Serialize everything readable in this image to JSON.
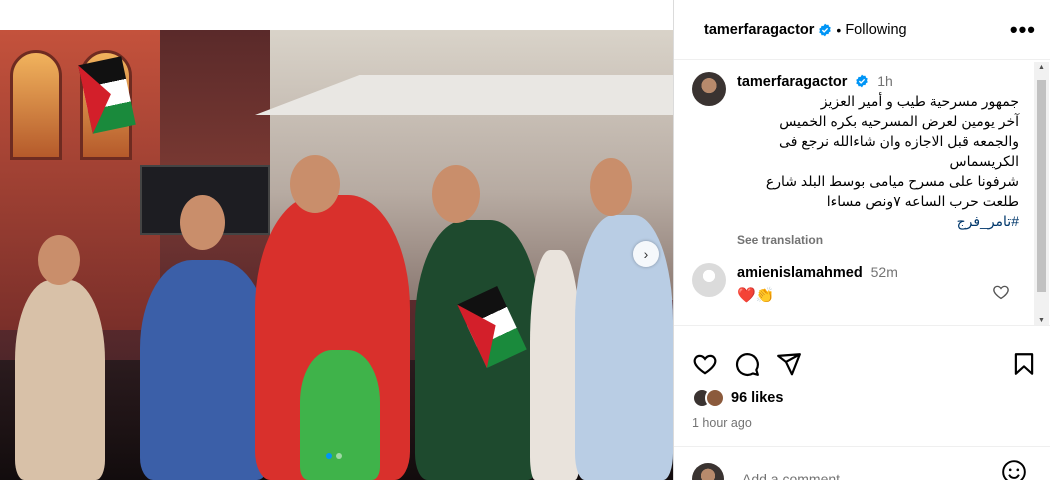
{
  "post": {
    "author": "tamerfaragactor",
    "follow_status": "Following",
    "separator": "•",
    "more_icon": "more-horizontal-icon",
    "caption_time": "1h",
    "caption_lines": [
      "جمهور مسرحية طيب و أمير العزيز",
      "آخر يومين لعرض المسرحيه بكره الخميس",
      "والجمعه قبل الاجازه وان شاءالله نرجع فى",
      "الكريسماس",
      "شرفونا على مسرح ميامى بوسط البلد شارع",
      "طلعت حرب الساعه ٧ونص مساءا"
    ],
    "hashtag": "#تامر_فرج",
    "see_translation": "See translation",
    "likes": "96 likes",
    "posted_ago": "1 hour ago"
  },
  "comments": [
    {
      "user": "amienislamahmed",
      "time": "52m",
      "text": "❤️👏"
    }
  ],
  "composer": {
    "placeholder": "Add a comment..."
  },
  "colors": {
    "link": "#00376b",
    "secondary": "#737373",
    "accent": "#0095f6",
    "verified": "#0095f6"
  },
  "carousel": {
    "slides": 2,
    "active_index": 0
  }
}
